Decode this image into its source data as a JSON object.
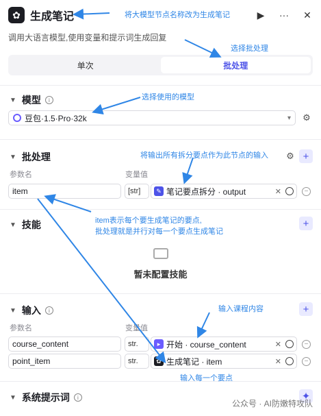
{
  "header": {
    "title": "生成笔记",
    "run_icon": "play-circle-icon",
    "more_icon": "more-icon",
    "close_icon": "close-icon"
  },
  "description": "调用大语言模型,使用变量和提示词生成回复",
  "tabs": [
    {
      "label": "单次"
    },
    {
      "label": "批处理",
      "active": true
    }
  ],
  "model_section": {
    "title": "模型",
    "selected": "豆包·1.5·Pro·32k"
  },
  "batch_section": {
    "title": "批处理",
    "col_param": "参数名",
    "col_value": "变量值",
    "rows": [
      {
        "name": "item",
        "type": "[str]",
        "ref_text": "笔记要点拆分 · output"
      }
    ]
  },
  "skills_section": {
    "title": "技能",
    "empty_text": "暂未配置技能"
  },
  "input_section": {
    "title": "输入",
    "col_param": "参数名",
    "col_value": "变量值",
    "rows": [
      {
        "name": "course_content",
        "type": "str.",
        "ref_text": "开始 · course_content"
      },
      {
        "name": "point_item",
        "type": "str.",
        "ref_text": "生成笔记 · item"
      }
    ]
  },
  "system_prompt_section": {
    "title": "系统提示词"
  },
  "annotations": {
    "rename": "将大模型节点名称改为生成笔记",
    "batch": "选择批处理",
    "model": "选择使用的模型",
    "batch_input": "将输出所有拆分要点作为此节点的输入",
    "item_line1": "item表示每个要生成笔记的要点,",
    "item_line2": "批处理就是并行对每一个要点生成笔记",
    "course": "输入课程内容",
    "point": "输入每一个要点"
  },
  "watermark": "公众号 · AI防嫩特攻队",
  "colors": {
    "accent": "#4d53e8",
    "annotation": "#2f86e6"
  }
}
